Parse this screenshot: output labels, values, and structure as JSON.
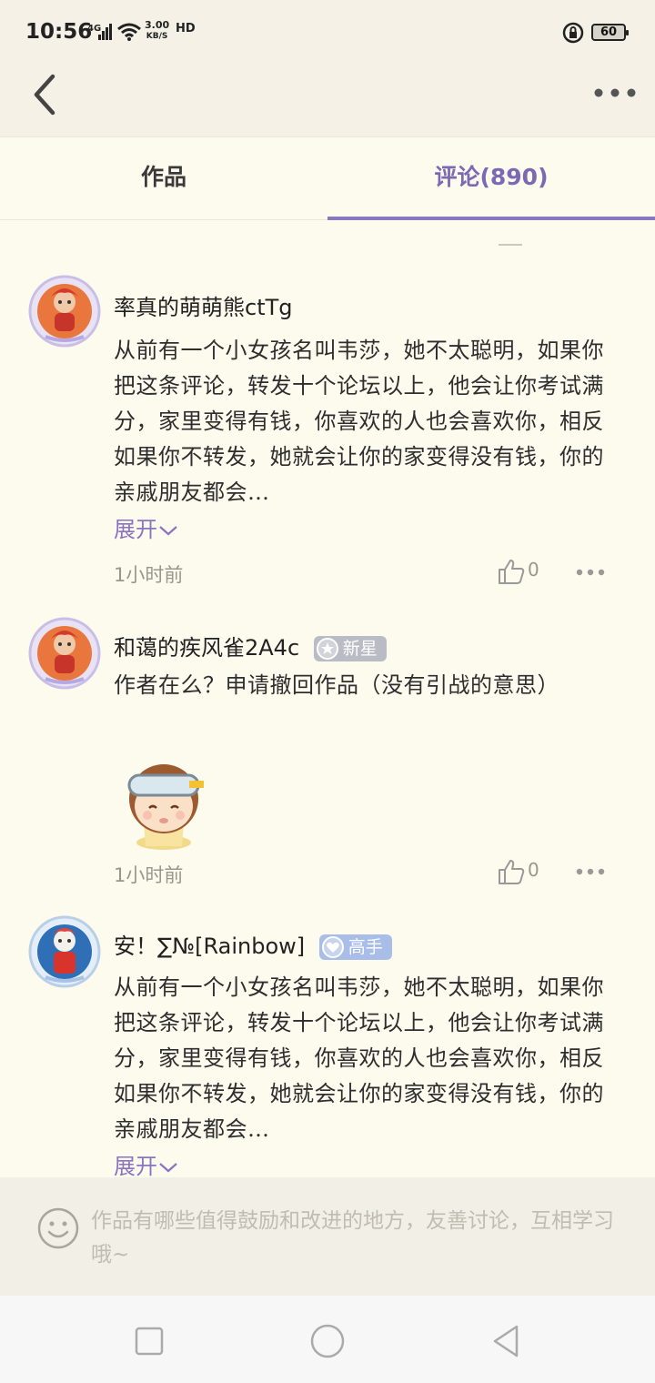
{
  "status_bar": {
    "time": "10:56",
    "network": "4G",
    "speed_value": "3.00",
    "speed_unit": "KB/S",
    "hd": "HD",
    "battery": "60"
  },
  "header": {
    "back_icon": "back-arrow-icon",
    "more_icon": "more-dots-icon"
  },
  "tabs": [
    {
      "label": "作品",
      "active": false
    },
    {
      "label": "评论(890)",
      "active": true
    }
  ],
  "accent_color": "#8a77bf",
  "comments": [
    {
      "username": "率真的萌萌熊ctTg",
      "badge": "",
      "text": "从前有一个小女孩名叫韦莎，她不太聪明，如果你把这条评论，转发十个论坛以上，他会让你考试满分，家里变得有钱，你喜欢的人也会喜欢你，相反如果你不转发，她就会让你的家变得没有钱，你的亲戚朋友都会…",
      "expand": "展开",
      "time": "1小时前",
      "likes": "0"
    },
    {
      "username": "和蔼的疾风雀2A4c",
      "badge": "新星",
      "text": "作者在么？申请撤回作品（没有引战的意思）",
      "time": "1小时前",
      "likes": "0"
    },
    {
      "username": "安！∑№[Rainbow]",
      "badge": "高手",
      "text": "从前有一个小女孩名叫韦莎，她不太聪明，如果你把这条评论，转发十个论坛以上，他会让你考试满分，家里变得有钱，你喜欢的人也会喜欢你，相反如果你不转发，她就会让你的家变得没有钱，你的亲戚朋友都会…",
      "expand": "展开"
    }
  ],
  "composer": {
    "placeholder": "作品有哪些值得鼓励和改进的地方，友善讨论，互相学习哦~",
    "icon": "smile-icon"
  },
  "nav": [
    "recent-apps-icon",
    "home-icon",
    "back-icon"
  ]
}
